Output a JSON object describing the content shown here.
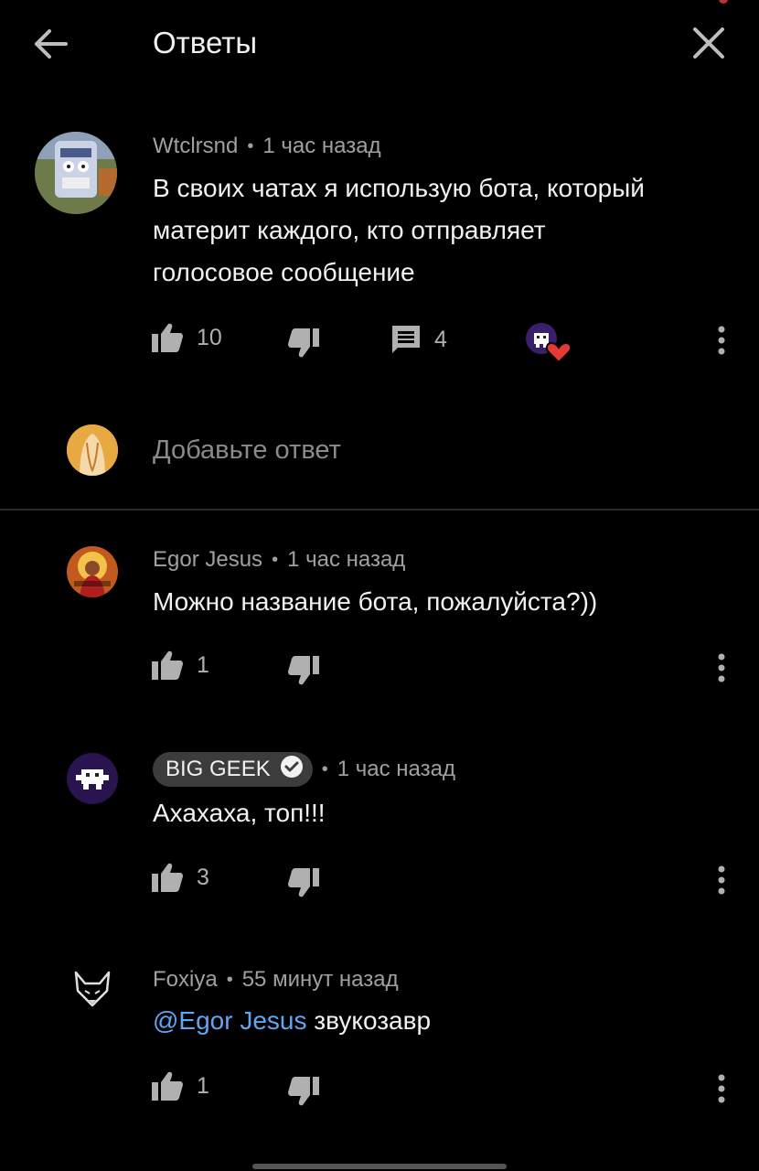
{
  "header": {
    "title": "Ответы"
  },
  "root_comment": {
    "author": "Wtclrsnd",
    "time": "1 час назад",
    "text": "В своих чатах я использую бота, который материт каждого, кто отправляет голосовое сообщение",
    "likes": "10",
    "replies": "4"
  },
  "reply_input": {
    "placeholder": "Добавьте ответ"
  },
  "replies": [
    {
      "author": "Egor Jesus",
      "time": "1 час назад",
      "text": "Можно название бота, пожалуйста?))",
      "likes": "1"
    },
    {
      "author": "BIG GEEK",
      "verified": true,
      "time": "1 час назад",
      "text": "Ахахаха, топ!!!",
      "likes": "3"
    },
    {
      "author": "Foxiya",
      "time": "55 минут назад",
      "mention": "@Egor Jesus",
      "text": "звукозавр",
      "likes": "1"
    }
  ],
  "colors": {
    "background": "#000000",
    "mention": "#5fa6f5",
    "heart": "#e53935",
    "meta": "#a0a0a0"
  }
}
